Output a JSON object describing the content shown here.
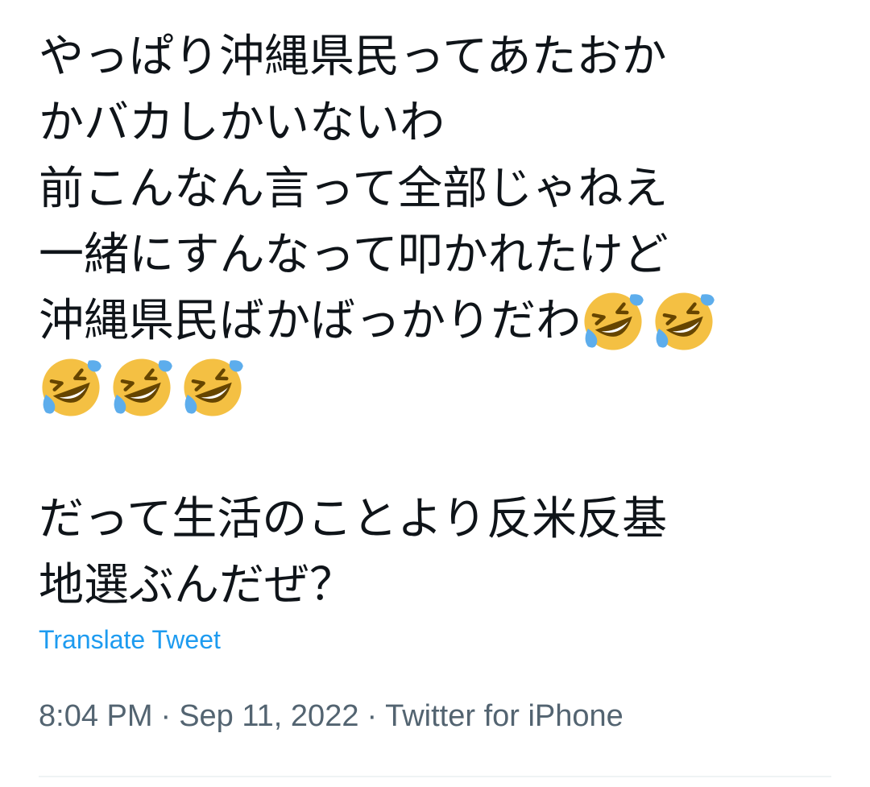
{
  "tweet": {
    "lines": [
      "やっぱり沖縄県民ってあたおか",
      "かバカしかいないわ",
      "前こんなん言って全部じゃねえ",
      "一緒にすんなって叩かれたけど",
      "沖縄県民ばかばっかりだわ",
      "",
      "",
      "だって生活のことより反米反基",
      "地選ぶんだぜ？"
    ],
    "emoji_name": "rolling-on-the-floor-laughing",
    "emoji_count_line5": 2,
    "emoji_count_line6": 3
  },
  "translate_label": "Translate Tweet",
  "meta": {
    "time": "8:04 PM",
    "date": "Sep 11, 2022",
    "source": "Twitter for iPhone",
    "separator": "·"
  },
  "colors": {
    "text": "#0f1419",
    "link": "#1d9bf0",
    "secondary": "#536471",
    "divider": "#eff3f4",
    "emoji_face": "#f4c043",
    "emoji_tear": "#5dadec"
  }
}
